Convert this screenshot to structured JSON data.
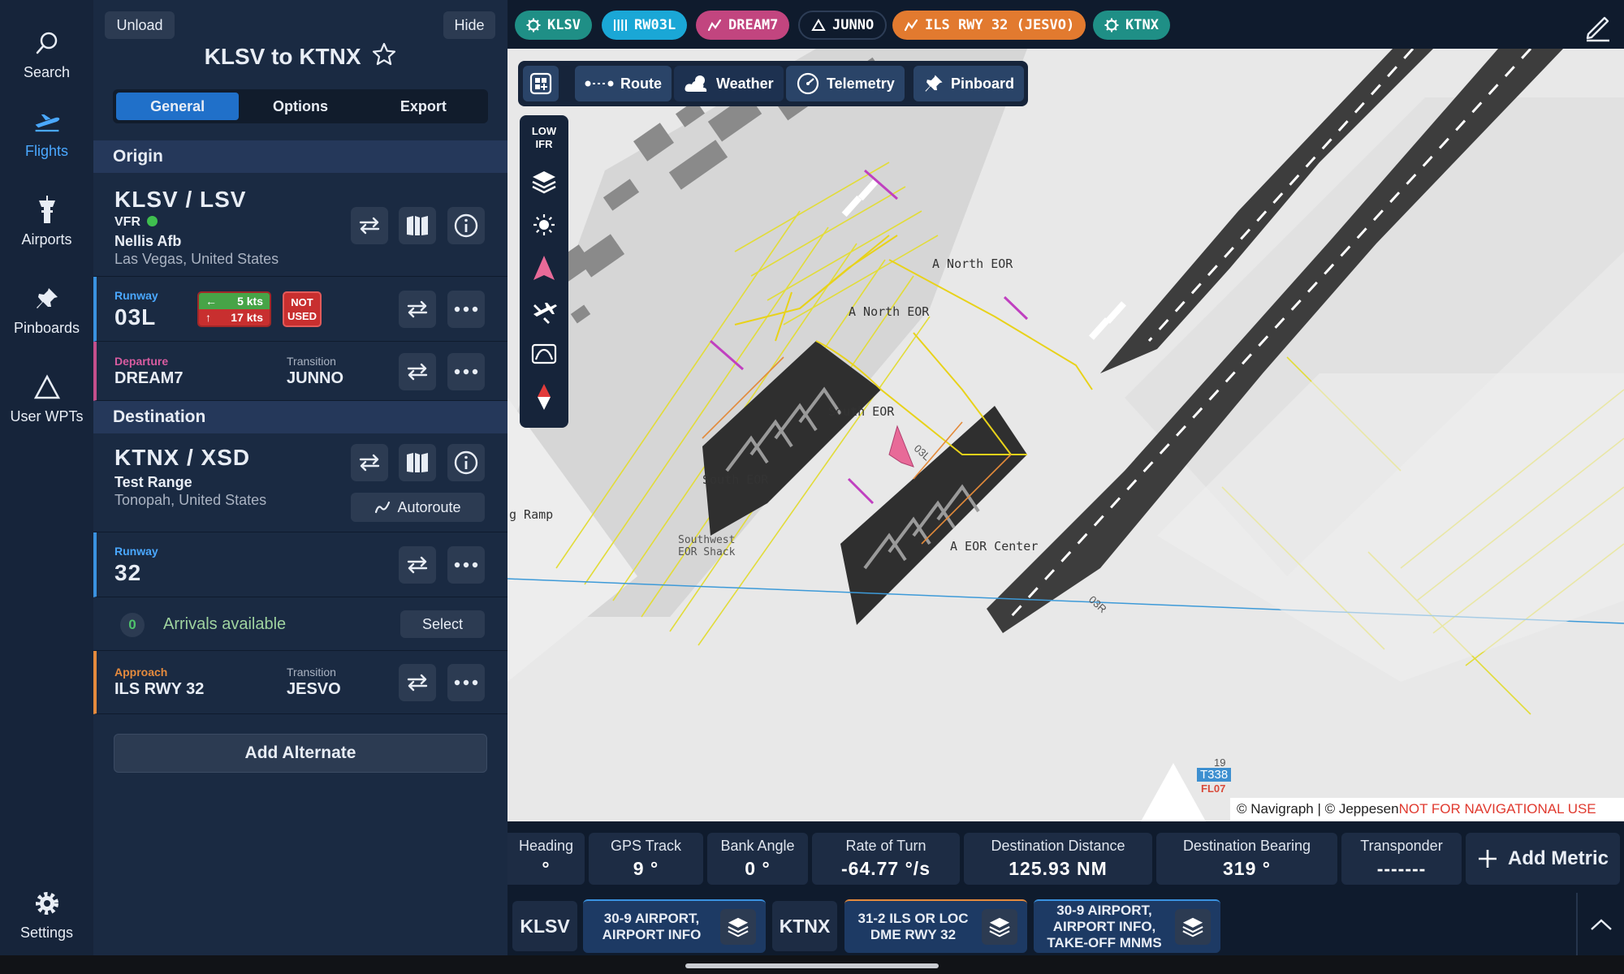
{
  "rail": {
    "search": "Search",
    "flights": "Flights",
    "airports": "Airports",
    "pinboards": "Pinboards",
    "user_wpts": "User WPTs",
    "settings": "Settings"
  },
  "panel": {
    "unload": "Unload",
    "hide": "Hide",
    "title": "KLSV to KTNX",
    "tabs": [
      "General",
      "Options",
      "Export"
    ],
    "origin": {
      "header": "Origin",
      "ident": "KLSV / LSV",
      "flight_rules": "VFR",
      "name": "Nellis Afb",
      "location": "Las Vegas, United States",
      "runway_label": "Runway",
      "runway": "03L",
      "headwind": "5 kts",
      "crosswind": "17 kts",
      "not_used": [
        "NOT",
        "USED"
      ],
      "departure_label": "Departure",
      "departure": "DREAM7",
      "transition_label": "Transition",
      "transition": "JUNNO"
    },
    "destination": {
      "header": "Destination",
      "ident": "KTNX / XSD",
      "name": "Test Range",
      "location": "Tonopah, United States",
      "autoroute": "Autoroute",
      "runway_label": "Runway",
      "runway": "32",
      "arrivals_count": "0",
      "arrivals_text": "Arrivals available",
      "select": "Select",
      "approach_label": "Approach",
      "approach": "ILS RWY 32",
      "transition_label": "Transition",
      "transition": "JESVO"
    },
    "add_alternate": "Add Alternate"
  },
  "chips": [
    {
      "label": "KLSV",
      "color": "#1f8f86"
    },
    {
      "label": "RW03L",
      "color": "#1aa7d6"
    },
    {
      "label": "DREAM7",
      "color": "#c2457f"
    },
    {
      "label": "JUNNO",
      "color": "#0f1b2d"
    },
    {
      "label": "ILS RWY 32 (JESVO)",
      "color": "#e27a2f"
    },
    {
      "label": "KTNX",
      "color": "#1f8f86"
    }
  ],
  "map_toolbar": {
    "route": "Route",
    "weather": "Weather",
    "telemetry": "Telemetry",
    "pinboard": "Pinboard"
  },
  "side_tools": {
    "wx_top": "LOW",
    "wx_bottom": "IFR"
  },
  "map_labels": {
    "north_eor_1": "A North EOR",
    "north_eor_2": "A North EOR",
    "south_eor_1": "South EOR",
    "south_eor_2": "South EOR",
    "eor_center": "A EOR Center",
    "sw_shack_1": "Southwest",
    "sw_shack_2": "EOR Shack",
    "ramp": "g Ramp",
    "airway": "T338",
    "airway_alt": "FL07",
    "airway_num": "19",
    "rwy_03l": "03L",
    "rwy_03r": "03R"
  },
  "copyright": {
    "text": "© Navigraph | © Jeppesen ",
    "warning": "NOT FOR NAVIGATIONAL USE"
  },
  "metrics": [
    {
      "label": "Heading",
      "value": "°"
    },
    {
      "label": "GPS Track",
      "value": "9 °"
    },
    {
      "label": "Bank Angle",
      "value": "0 °"
    },
    {
      "label": "Rate of Turn",
      "value": "-64.77 °/s"
    },
    {
      "label": "Destination Distance",
      "value": "125.93 NM"
    },
    {
      "label": "Destination Bearing",
      "value": "319 °"
    },
    {
      "label": "Transponder",
      "value": "-------"
    }
  ],
  "add_metric": "Add Metric",
  "docs": {
    "origin_id": "KLSV",
    "origin_doc": [
      "30-9 AIRPORT,",
      "AIRPORT INFO"
    ],
    "dest_id": "KTNX",
    "dest_doc_1": [
      "31-2 ILS OR LOC",
      "DME RWY 32"
    ],
    "dest_doc_2": [
      "30-9 AIRPORT,",
      "AIRPORT INFO,",
      "TAKE-OFF MNMS"
    ]
  }
}
